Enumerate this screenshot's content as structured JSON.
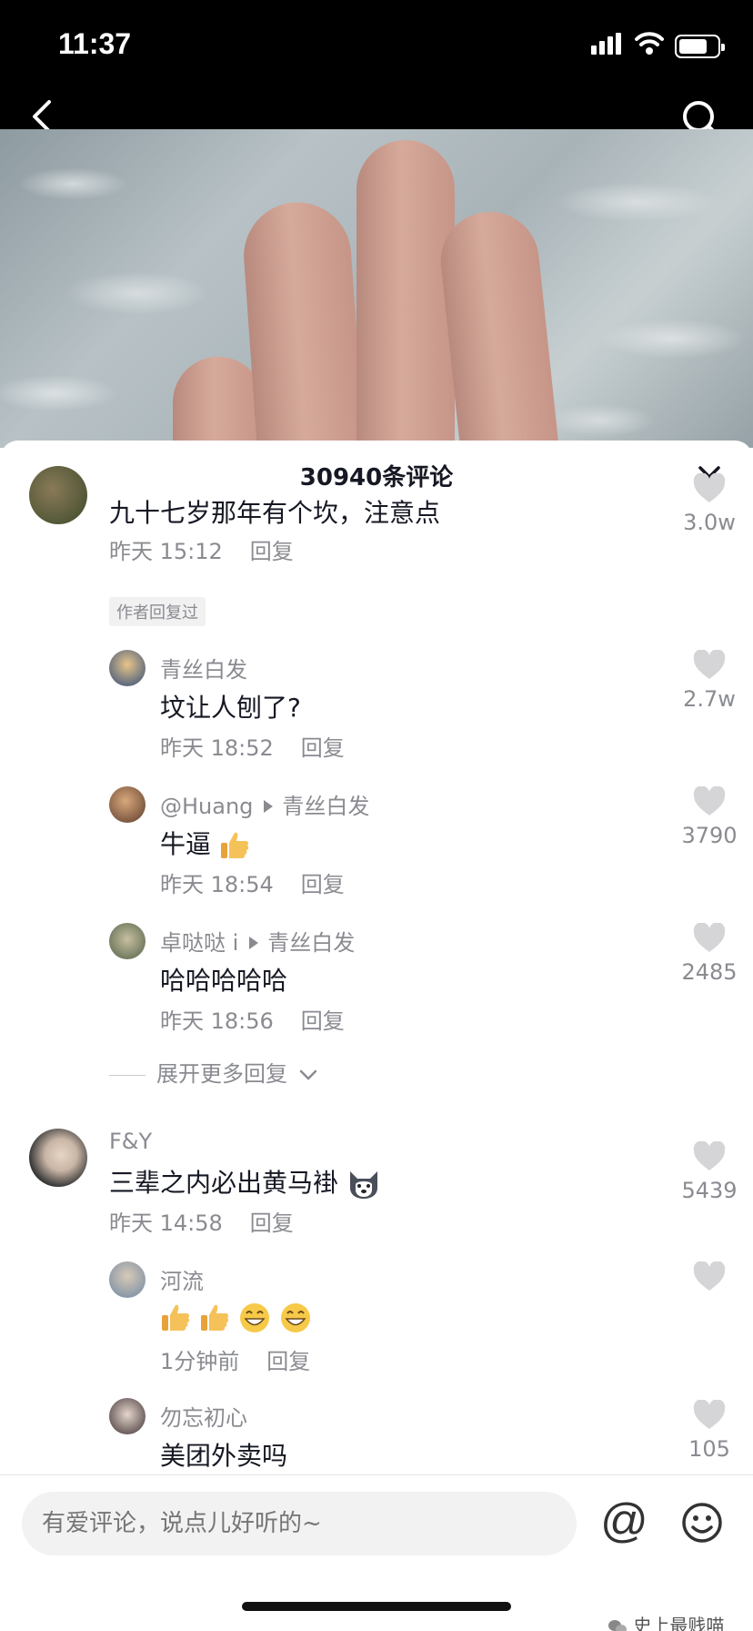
{
  "status_bar": {
    "time": "11:37"
  },
  "header": {
    "back_icon": "chevron-left-icon",
    "search_icon": "search-icon"
  },
  "panel": {
    "title": "30940条评论",
    "close_icon": "close-icon"
  },
  "comments": [
    {
      "user": "",
      "text": "九十七岁那年有个坎，注意点",
      "time": "昨天 15:12",
      "reply": "回复",
      "likes": "3.0w",
      "badge": "作者回复过",
      "replies": [
        {
          "user": "青丝白发",
          "to": "",
          "text": "坟让人刨了?",
          "time": "昨天 18:52",
          "reply": "回复",
          "likes": "2.7w"
        },
        {
          "user": "@Huang",
          "to": "青丝白发",
          "text": "牛逼",
          "emoji": [
            "thumbs-up-icon"
          ],
          "time": "昨天 18:54",
          "reply": "回复",
          "likes": "3790"
        },
        {
          "user": "卓哒哒 i",
          "to": "青丝白发",
          "text": "哈哈哈哈哈",
          "time": "昨天 18:56",
          "reply": "回复",
          "likes": "2485"
        }
      ],
      "expand": "展开更多回复"
    },
    {
      "user": "F&Y",
      "text": "三辈之内必出黄马褂",
      "emoji": [
        "husky-face-icon"
      ],
      "time": "昨天 14:58",
      "reply": "回复",
      "likes": "5439",
      "replies": [
        {
          "user": "河流",
          "to": "",
          "text": "",
          "emoji": [
            "thumbs-up-icon",
            "thumbs-up-icon",
            "grin-icon",
            "grin-icon"
          ],
          "time": "1分钟前",
          "reply": "回复",
          "likes": ""
        },
        {
          "user": "勿忘初心",
          "to": "",
          "text": "美团外卖吗",
          "time": "",
          "reply": "",
          "likes": "105"
        }
      ]
    }
  ],
  "input": {
    "placeholder": "有爱评论，说点儿好听的~",
    "at_label": "@",
    "emoji_icon": "smiley-icon"
  },
  "watermark": "史上最贱喵",
  "colors": {
    "primary_text": "#161823",
    "secondary_text": "#8a8b91",
    "like_icon": "#d5d5d8"
  }
}
